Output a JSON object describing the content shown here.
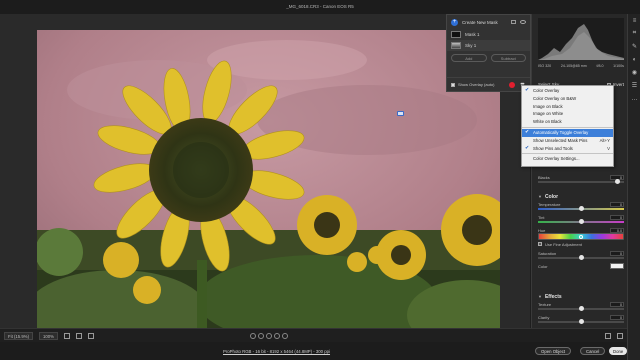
{
  "window": {
    "title": "_MG_6018.CR3  -  Canon EOS R5"
  },
  "mask_panel": {
    "create_label": "Create New Mask",
    "masks": [
      {
        "label": "Mask 1"
      },
      {
        "label": "Sky 1"
      }
    ],
    "add_label": "Add",
    "subtract_label": "Subtract",
    "show_overlay_label": "Show Overlay (auto)"
  },
  "histogram": {
    "info": [
      "ISO 320",
      "24-105@85 mm",
      "f/8.0",
      "1/100s"
    ],
    "info2": [
      "",
      "",
      "",
      ""
    ]
  },
  "sky_select": {
    "label": "Select Sky",
    "invert_label": "Invert"
  },
  "menu": {
    "items": [
      {
        "label": "Color Overlay",
        "checked": true,
        "shortcut": ""
      },
      {
        "label": "Color Overlay on B&W",
        "checked": false,
        "shortcut": ""
      },
      {
        "label": "Image on Black",
        "checked": false,
        "shortcut": ""
      },
      {
        "label": "Image on White",
        "checked": false,
        "shortcut": ""
      },
      {
        "label": "White on Black",
        "checked": false,
        "shortcut": ""
      },
      {
        "label": "Automatically Toggle Overlay",
        "checked": true,
        "shortcut": "",
        "hover": true
      },
      {
        "label": "Show Unselected Mask Pins",
        "checked": false,
        "shortcut": "Alt+Y"
      },
      {
        "label": "Show Pins and Tools",
        "checked": true,
        "shortcut": "V"
      },
      {
        "label": "Color Overlay Settings...",
        "checked": false,
        "shortcut": ""
      }
    ]
  },
  "adjustments": {
    "blacks": {
      "label": "Blacks",
      "value": "0",
      "pos": 0.5
    },
    "color_section": "Color",
    "temperature": {
      "label": "Temperature",
      "value": "0",
      "pos": 0.5
    },
    "tint": {
      "label": "Tint",
      "value": "0",
      "pos": 0.5
    },
    "hue": {
      "label": "Hue",
      "value": "0.0"
    },
    "fine_adjust": "Use Fine Adjustment",
    "saturation": {
      "label": "Saturation",
      "value": "0",
      "pos": 0.5
    },
    "color": {
      "label": "Color"
    },
    "effects_section": "Effects",
    "texture": {
      "label": "Texture",
      "value": "0",
      "pos": 0.5
    },
    "clarity": {
      "label": "Clarity",
      "value": "0",
      "pos": 0.5
    },
    "dehaze": {
      "label": "Dehaze",
      "value": "0",
      "pos": 0.5
    }
  },
  "statusbar": {
    "fit_label": "Fit (15.9%)",
    "zoom_label": "100%"
  },
  "footer": {
    "workflow_link": "ProPhoto RGB - 16 bit - 8192 x 5464 (44.8MP) - 300 ppi",
    "open_label": "Open Object",
    "cancel_label": "Cancel",
    "done_label": "Done"
  },
  "colors": {
    "accent": "#2f6fd6",
    "overlay_tint": "#c88a96",
    "menu_hover": "#3d7fd9"
  }
}
